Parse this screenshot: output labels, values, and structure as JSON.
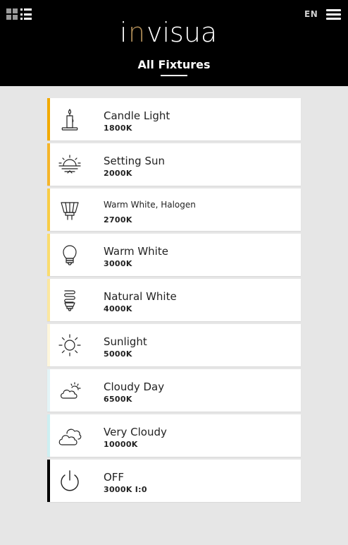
{
  "header": {
    "brand": "invisua",
    "language": "EN",
    "title": "All Fixtures",
    "colors": {
      "background": "#000000",
      "brand_accent": "#b08d57"
    }
  },
  "fixtures": [
    {
      "label": "Candle Light",
      "temp": "1800K",
      "icon": "candle-icon",
      "color": "#f2a900"
    },
    {
      "label": "Setting Sun",
      "temp": "2000K",
      "icon": "sunset-icon",
      "color": "#f5b52a"
    },
    {
      "label": "Warm White, Halogen",
      "temp": "2700K",
      "icon": "halogen-spot-icon",
      "color": "#f8cc45"
    },
    {
      "label": "Warm White",
      "temp": "3000K",
      "icon": "bulb-icon",
      "color": "#fadc6e"
    },
    {
      "label": "Natural White",
      "temp": "4000K",
      "icon": "spiral-bulb-icon",
      "color": "#fbe7a0"
    },
    {
      "label": "Sunlight",
      "temp": "5000K",
      "icon": "sun-icon",
      "color": "#fdf6dc"
    },
    {
      "label": "Cloudy Day",
      "temp": "6500K",
      "icon": "partly-cloudy-icon",
      "color": "#e3f4f7"
    },
    {
      "label": "Very Cloudy",
      "temp": "10000K",
      "icon": "clouds-icon",
      "color": "#cdeff2"
    },
    {
      "label": "OFF",
      "temp": "3000K I:0",
      "icon": "power-icon",
      "color": "#000000"
    }
  ]
}
